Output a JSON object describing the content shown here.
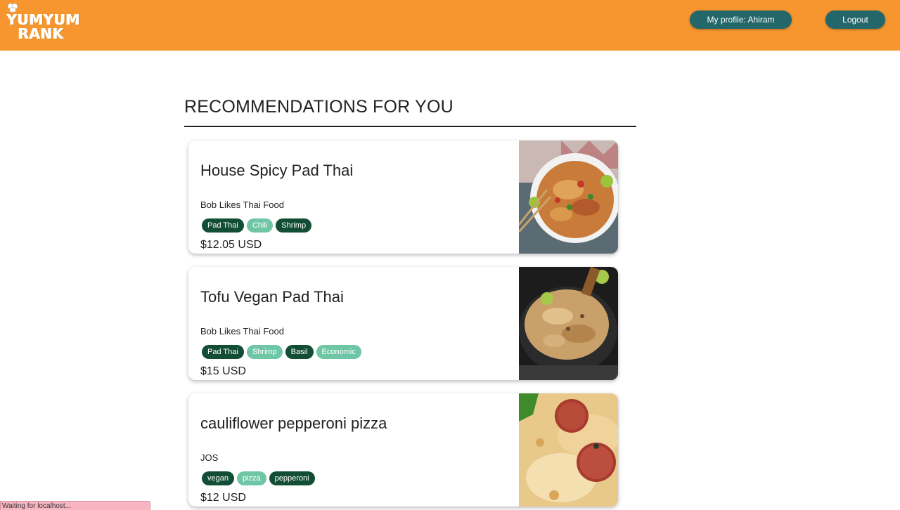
{
  "header": {
    "logo_line1": "YUMYUM",
    "logo_line2": "RANK",
    "profile_button": "My profile: Ahiram",
    "logout_button": "Logout"
  },
  "main": {
    "section_title": "RECOMMENDATIONS FOR YOU",
    "cards": [
      {
        "title": "House Spicy Pad Thai",
        "vendor": "Bob Likes Thai Food",
        "tags": [
          {
            "label": "Pad Thai",
            "style": "dark"
          },
          {
            "label": "Chili",
            "style": "light"
          },
          {
            "label": "Shrimp",
            "style": "dark"
          }
        ],
        "price": "$12.05 USD",
        "image": "pad-thai-bowl-photo"
      },
      {
        "title": "Tofu Vegan Pad Thai",
        "vendor": "Bob Likes Thai Food",
        "tags": [
          {
            "label": "Pad Thai",
            "style": "dark"
          },
          {
            "label": "Shrimp",
            "style": "light"
          },
          {
            "label": "Basil",
            "style": "dark"
          },
          {
            "label": "Economic",
            "style": "light"
          }
        ],
        "price": "$15 USD",
        "image": "pad-thai-pan-photo"
      },
      {
        "title": "cauliflower pepperoni pizza",
        "vendor": "JOS",
        "tags": [
          {
            "label": "vegan",
            "style": "dark"
          },
          {
            "label": "pizza",
            "style": "light"
          },
          {
            "label": "pepperoni",
            "style": "dark"
          }
        ],
        "price": "$12 USD",
        "image": "pepperoni-pizza-photo"
      }
    ]
  },
  "status_bar": "Waiting for localhost...",
  "colors": {
    "header_bg": "#f7962e",
    "button_bg": "#23676a",
    "tag_dark": "#124d35",
    "tag_light": "#6fc6a6"
  }
}
